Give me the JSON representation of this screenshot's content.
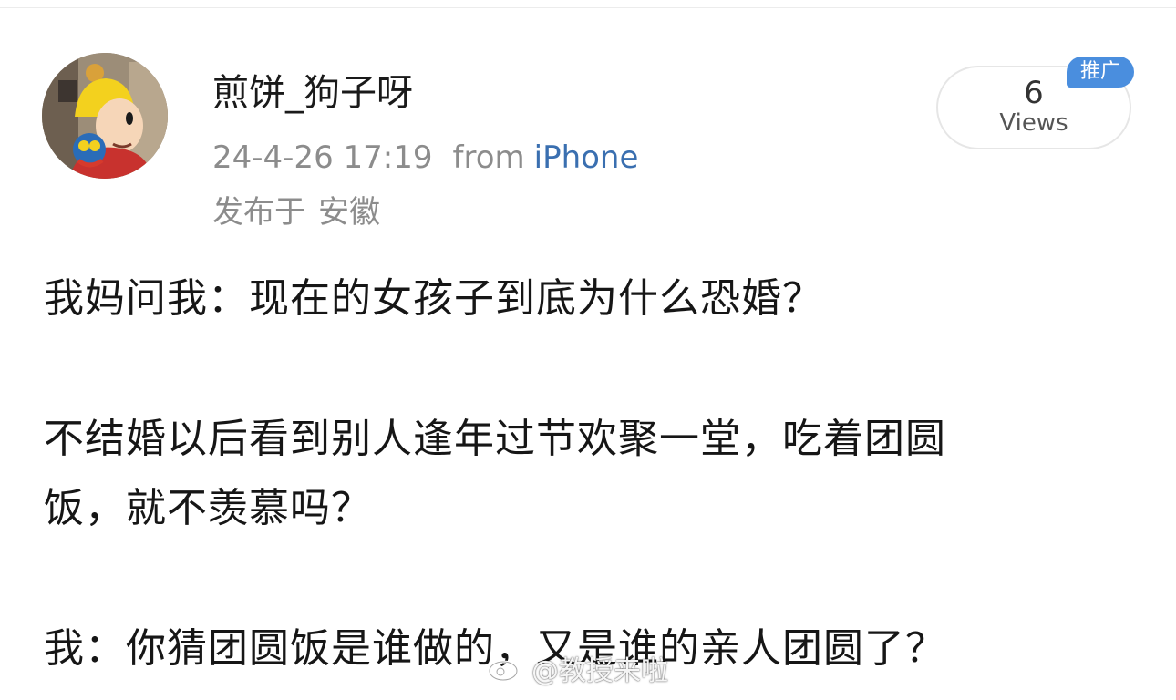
{
  "post": {
    "author": {
      "username": "煎饼_狗子呀",
      "avatar": "avatar-cartoon-character"
    },
    "timestamp": "24-4-26 17:19",
    "from_label": "from",
    "device": "iPhone",
    "location_prefix": "发布于",
    "location": "安徽",
    "views": {
      "count": "6",
      "label": "Views"
    },
    "promo_tag": "推广",
    "body": [
      "我妈问我：现在的女孩子到底为什么恐婚？",
      "不结婚以后看到别人逢年过节欢聚一堂，吃着团圆",
      "饭，就不羡慕吗？",
      "我：你猜团圆饭是谁做的，又是谁的亲人团圆了？"
    ]
  },
  "watermark": {
    "text": "@教授来啦",
    "icon": "weibo-icon"
  },
  "colors": {
    "link_blue": "#3a6fb0",
    "meta_gray": "#8c8c8c",
    "promo_blue": "#4a8ede"
  }
}
